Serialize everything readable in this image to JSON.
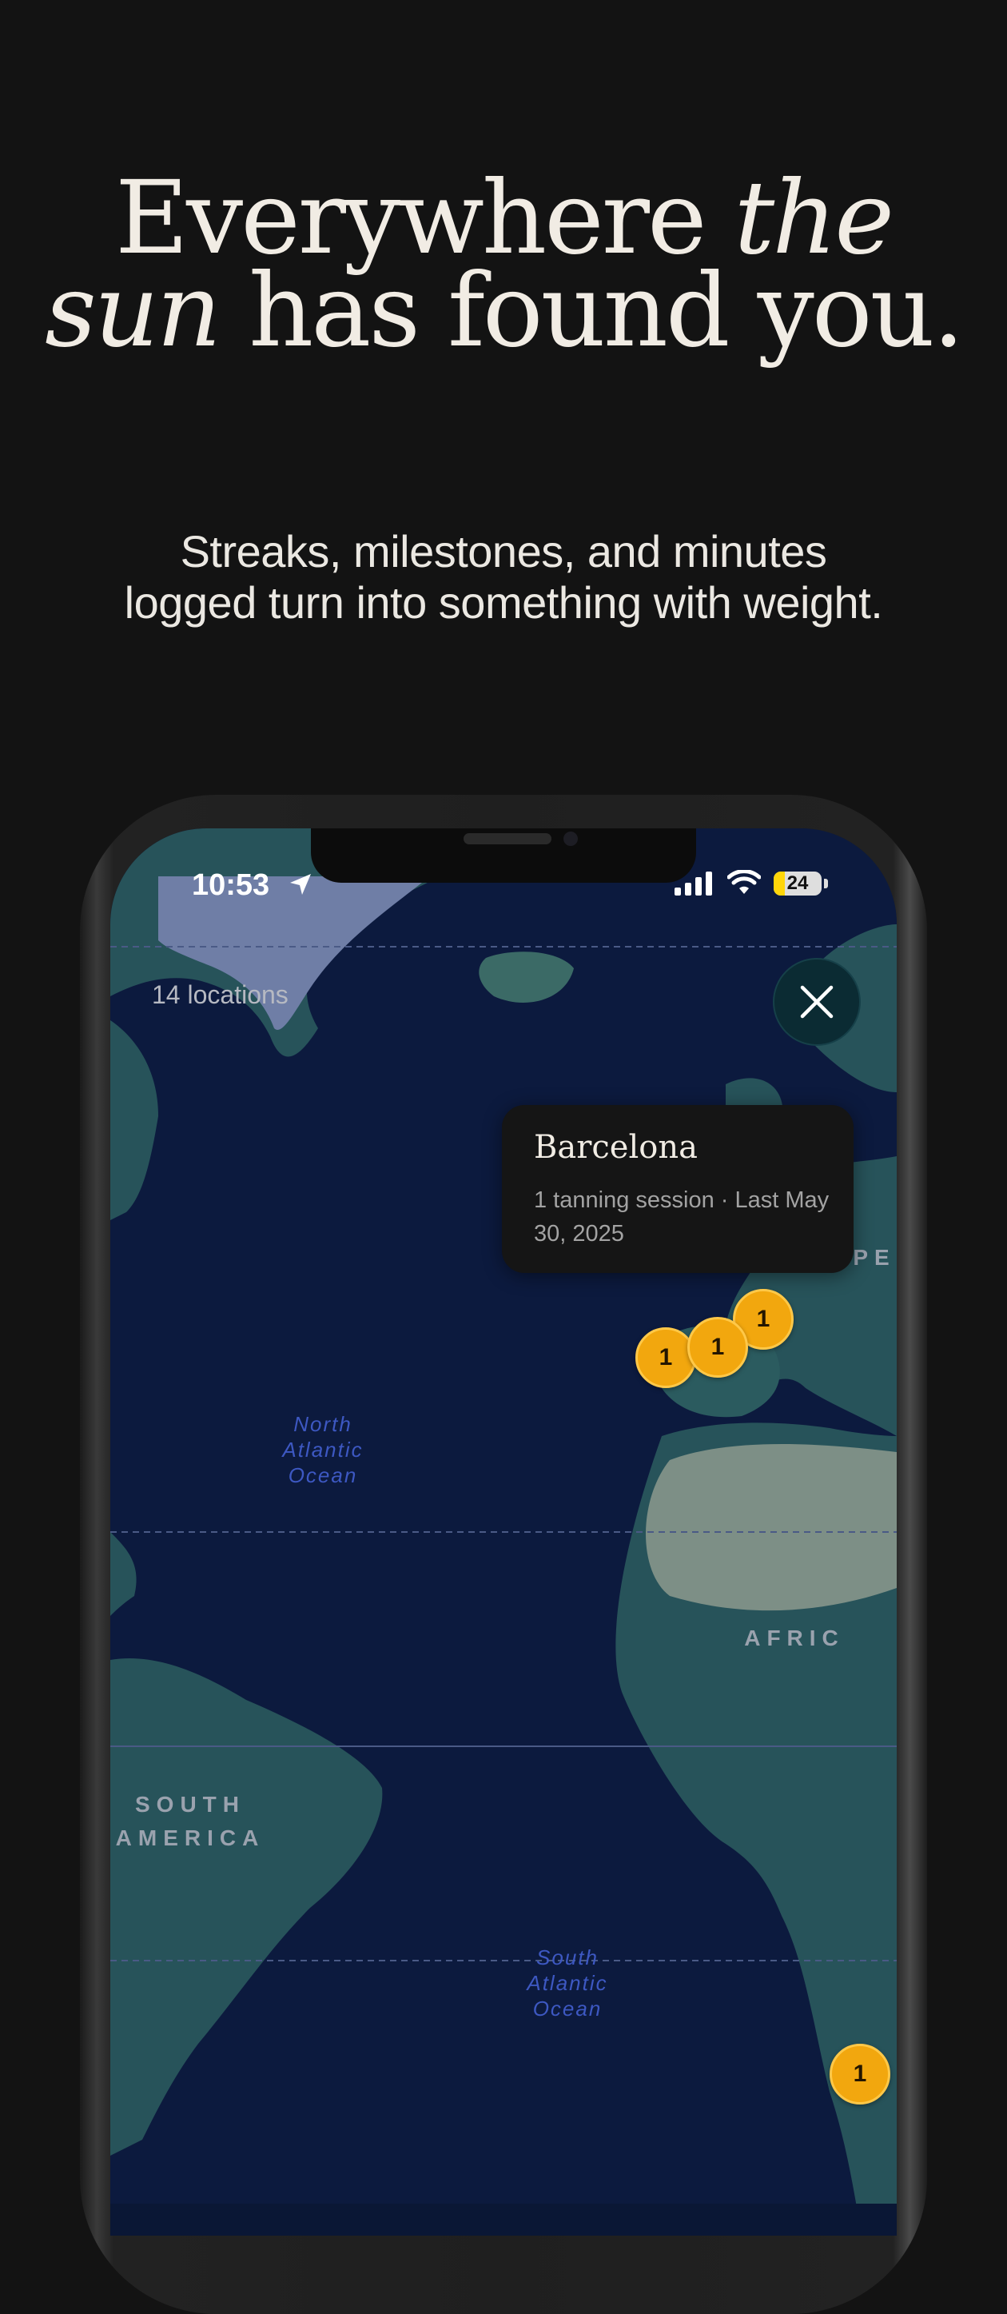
{
  "headline": {
    "part1": "Everywhere ",
    "part2_italic": "the",
    "part3_italic": "sun",
    "part4": " has found you."
  },
  "subhead": "Streaks, milestones, and minutes logged turn into something with weight.",
  "status_bar": {
    "time": "10:53",
    "battery": "24",
    "battery_level_percent": 24
  },
  "map": {
    "location_count": "14 locations",
    "close_icon": "close-icon",
    "labels": {
      "north_atlantic": [
        "North",
        "Atlantic",
        "Ocean"
      ],
      "south_atlantic": [
        "South",
        "Atlantic",
        "Ocean"
      ],
      "south_america": [
        "SOUTH",
        "AMERICA"
      ],
      "africa": "AFRIC",
      "europe_partial": "PE"
    },
    "popup": {
      "title": "Barcelona",
      "detail": "1 tanning session · Last May 30, 2025"
    },
    "markers": [
      {
        "count": "1"
      },
      {
        "count": "1"
      },
      {
        "count": "1"
      },
      {
        "count": "1"
      }
    ]
  },
  "colors": {
    "background": "#131313",
    "ocean": "#0c1a3e",
    "land": "#27535a",
    "marker": "#f2a70e",
    "headline": "#f1ece4"
  }
}
